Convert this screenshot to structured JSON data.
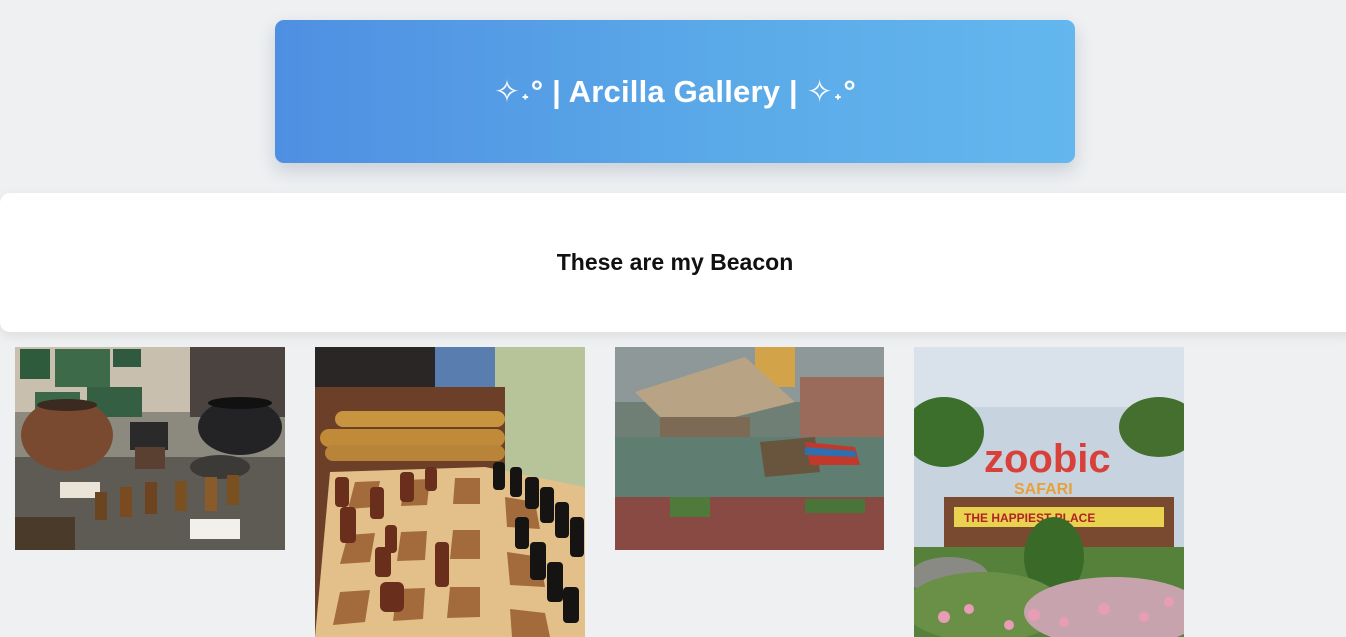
{
  "header": {
    "title": "✧˖° | Arcilla Gallery | ✧˖°"
  },
  "intro": {
    "text": "These are my Beacon"
  },
  "gallery": {
    "photos": [
      {
        "subject": "pottery-display"
      },
      {
        "subject": "chess-board"
      },
      {
        "subject": "diorama-raft"
      },
      {
        "subject": "zoo-entrance"
      }
    ],
    "photo4_sign": {
      "line1": "zoobic",
      "line2": "SAFARI",
      "line3": "THE HAPPIEST PLACE"
    }
  }
}
